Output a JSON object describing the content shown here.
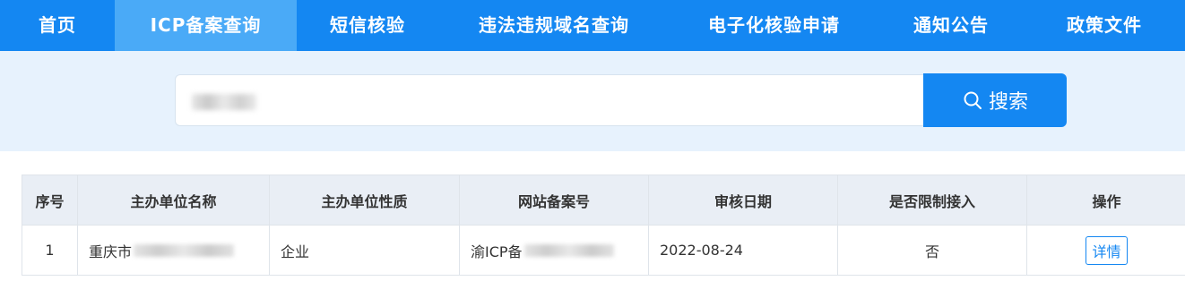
{
  "nav": {
    "items": [
      {
        "label": "首页"
      },
      {
        "label": "ICP备案查询",
        "active": true
      },
      {
        "label": "短信核验"
      },
      {
        "label": "违法违规域名查询"
      },
      {
        "label": "电子化核验申请"
      },
      {
        "label": "通知公告"
      },
      {
        "label": "政策文件"
      }
    ]
  },
  "search": {
    "button_label": "搜索",
    "icon": "search-icon"
  },
  "table": {
    "headers": [
      "序号",
      "主办单位名称",
      "主办单位性质",
      "网站备案号",
      "审核日期",
      "是否限制接入",
      "操作"
    ],
    "rows": [
      {
        "index": "1",
        "org_name": "重庆市",
        "org_type": "企业",
        "record_no": "渝ICP备",
        "review_date": "2022-08-24",
        "restricted": "否",
        "action": "详情"
      }
    ]
  },
  "colors": {
    "primary": "#1487f2",
    "nav_active": "#4aaaf7",
    "band": "#e7f2fd",
    "header_bg": "#e9eef5"
  }
}
